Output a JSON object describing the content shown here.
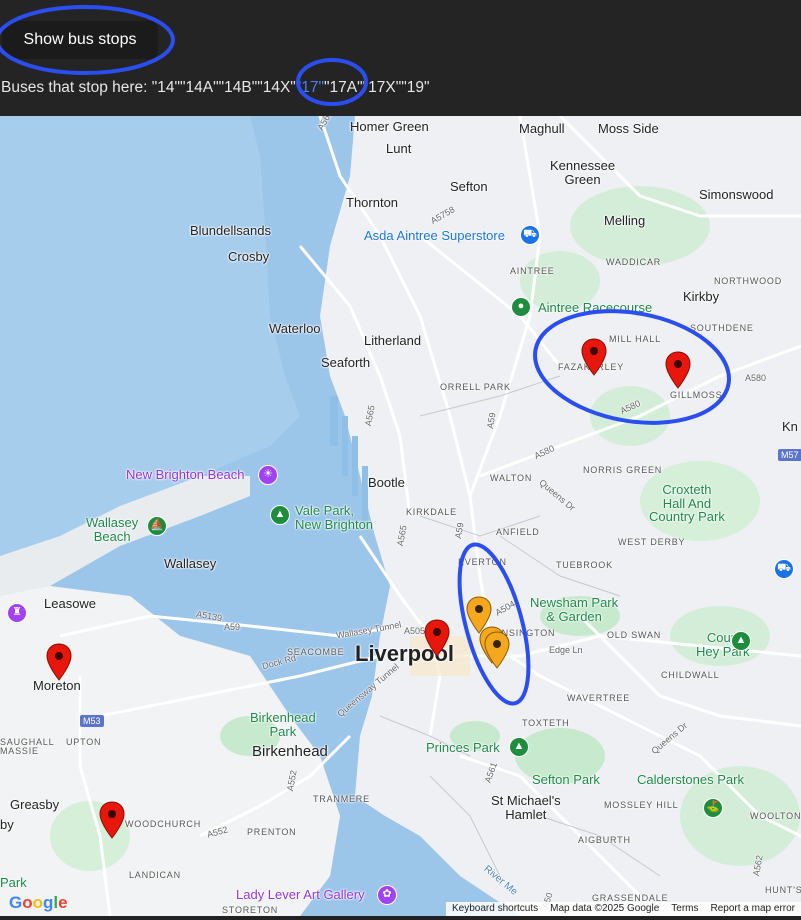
{
  "toolbar": {
    "show_stops_label": "Show bus stops"
  },
  "buses": {
    "prefix": "Buses that stop here: ",
    "routes_before": "\"14\"\"14A\"\"14B\"\"14X\"",
    "route_highlight": "\"17\"",
    "routes_after": "\"17A\"\"17X\"\"19\""
  },
  "map": {
    "labels": {
      "homer_green": "Homer Green",
      "lunt": "Lunt",
      "maghull": "Maghull",
      "moss_side": "Moss Side",
      "kennessee_green": "Kennessee\nGreen",
      "sefton": "Sefton",
      "thornton": "Thornton",
      "simonswood": "Simonswood",
      "melling": "Melling",
      "blundellsands": "Blundellsands",
      "crosby": "Crosby",
      "waddicar": "WADDICAR",
      "aintree": "AINTREE",
      "northwood": "NORTHWOOD",
      "kirkby": "Kirkby",
      "southdene": "SOUTHDENE",
      "waterloo": "Waterloo",
      "litherland": "Litherland",
      "seaforth": "Seaforth",
      "fazakerley": "FAZAKERLEY",
      "mill_hall": "MILL HALL",
      "gillmoss": "GILLMOSS",
      "orrell_park": "ORRELL PARK",
      "kn": "Kn",
      "norris_green": "NORRIS GREEN",
      "walton": "WALTON",
      "bootle": "Bootle",
      "croxteth": "Croxteth\nHall And\nCountry Park",
      "kirkdale": "KIRKDALE",
      "anfield": "ANFIELD",
      "west_derby": "WEST DERBY",
      "wallasey": "Wallasey",
      "everton": "EVERTON",
      "tuebrook": "TUEBROOK",
      "newsham_park": "Newsham Park\n& Garden",
      "leasowe": "Leasowe",
      "kensington": "KENSINGTON",
      "old_swan": "OLD SWAN",
      "seacombe": "SEACOMBE",
      "liverpool": "Liverpool",
      "court_hey": "Court\nHey Park",
      "moreton": "Moreton",
      "childwall": "CHILDWALL",
      "birkenhead_park": "Birkenhead\nPark",
      "wavertree": "WAVERTREE",
      "saughall_massie": "SAUGHALL\nMASSIE",
      "upton": "UPTON",
      "birkenhead": "Birkenhead",
      "toxteth": "TOXTETH",
      "princes_park": "Princes Park",
      "sefton_park": "Sefton Park",
      "calderstones": "Calderstones Park",
      "tranmere": "TRANMERE",
      "greasby": "Greasby",
      "st_michaels": "St Michael's\nHamlet",
      "mossley_hill": "MOSSLEY HILL",
      "woolton": "WOOLTON",
      "by": "by",
      "woodchurch": "WOODCHURCH",
      "prenton": "PRENTON",
      "aigburth": "AIGBURTH",
      "landican": "LANDICAN",
      "hunts_cross": "HUNT'S C",
      "grassendale": "GRASSENDALE",
      "storeton": "STORETON",
      "river_mersey": "River Me",
      "new_brighton": "New Brighton Beach",
      "vale_park": "Vale Park,\nNew Brighton",
      "wallasey_beach": "Wallasey\nBeach",
      "asda": "Asda Aintree Superstore",
      "aintree_racecourse": "Aintree Racecourse",
      "lady_lever": "Lady Lever Art Gallery",
      "park_label": "Park"
    },
    "roads": {
      "a565_top": "A565",
      "a5758": "A5758",
      "a59": "A59",
      "a580": "A580",
      "a580b": "A580",
      "a580c": "A580",
      "a565": "A565",
      "a5036": "A565",
      "a504": "A504",
      "a5139": "A5139",
      "a59b": "A59",
      "a5058": "A505",
      "a552": "A552",
      "a552b": "A552",
      "a561": "A561",
      "a562": "A562",
      "a5080": "A50",
      "m57": "M57",
      "m53": "M53",
      "wallasey_tunnel": "Wallasey Tunnel",
      "queensway": "Queensway Tunnel",
      "dock_rd": "Dock Rd",
      "queens_dr": "Queens Dr",
      "edge_ln": "Edge Ln",
      "queens_dr2": "Queens Dr",
      "queens_dr3": "Queens Dr"
    },
    "markers": {
      "red_colour": "#e8170b",
      "yellow_colour": "#f4a81d"
    }
  },
  "footer": {
    "google": "Google",
    "keyboard": "Keyboard shortcuts",
    "map_data": "Map data ©2025 Google",
    "terms": "Terms",
    "report": "Report a map error"
  },
  "annotation_colour": "#2a4ef0"
}
